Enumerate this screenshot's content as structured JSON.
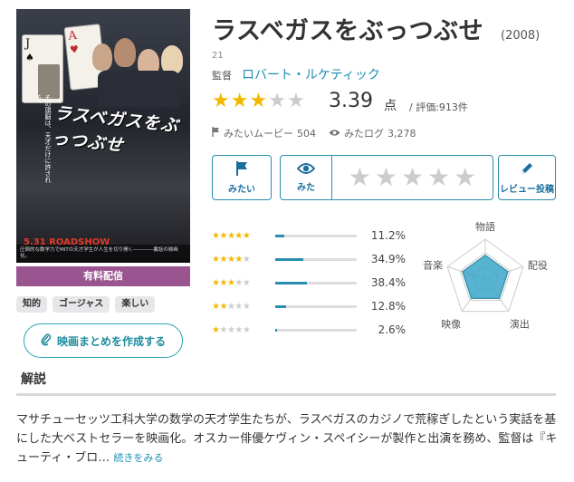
{
  "movie": {
    "title": "ラスベガスをぶっつぶせ",
    "year": "(2008)",
    "age_rating": "21",
    "director_label": "監督",
    "director": "ロバート・ルケティック",
    "score": "3.39",
    "score_unit": "点",
    "review_count": "/ 評価:913件",
    "stars_filled": 3,
    "stars_total": 5
  },
  "poster": {
    "title": "ラスベガスをぶっつぶせ",
    "tagline": "その頭脳は、天才だけに許される。",
    "date": "5.31 ROADSHOW",
    "strip": "圧倒的な数学力でMITの天才学生が人生を切り開く――――裏話の映画化。"
  },
  "stats": {
    "want_label": "みたいムービー",
    "want_count": "504",
    "log_label": "みたログ",
    "log_count": "3,278"
  },
  "actions": {
    "want": "みたい",
    "watched": "みた",
    "review": "レビュー投稿"
  },
  "stream_label": "有料配信",
  "tags": [
    "知的",
    "ゴージャス",
    "楽しい"
  ],
  "summary_button": "映画まとめを作成する",
  "distribution": [
    {
      "stars": 5,
      "pct_label": "11.2%",
      "pct": 11.2
    },
    {
      "stars": 4,
      "pct_label": "34.9%",
      "pct": 34.9
    },
    {
      "stars": 3,
      "pct_label": "38.4%",
      "pct": 38.4
    },
    {
      "stars": 2,
      "pct_label": "12.8%",
      "pct": 12.8
    },
    {
      "stars": 1,
      "pct_label": "2.6%",
      "pct": 2.6
    }
  ],
  "radar": {
    "labels": [
      "物語",
      "配役",
      "演出",
      "映像",
      "音楽"
    ],
    "values": [
      0.6,
      0.6,
      0.6,
      0.6,
      0.6
    ]
  },
  "section": {
    "title": "解説",
    "text": "マサチューセッツ工科大学の数学の天才学生たちが、ラスベガスのカジノで荒稼ぎしたという実話を基にした大ベストセラーを映画化。オスカー俳優ケヴィン・スペイシーが製作と出演を務め、監督は『キューティ・ブロ…",
    "more": "続きをみる"
  },
  "colors": {
    "accent": "#2a8db0",
    "star": "#f2b800",
    "stream": "#9a5591",
    "radar_fill": "#3aa6c8"
  }
}
